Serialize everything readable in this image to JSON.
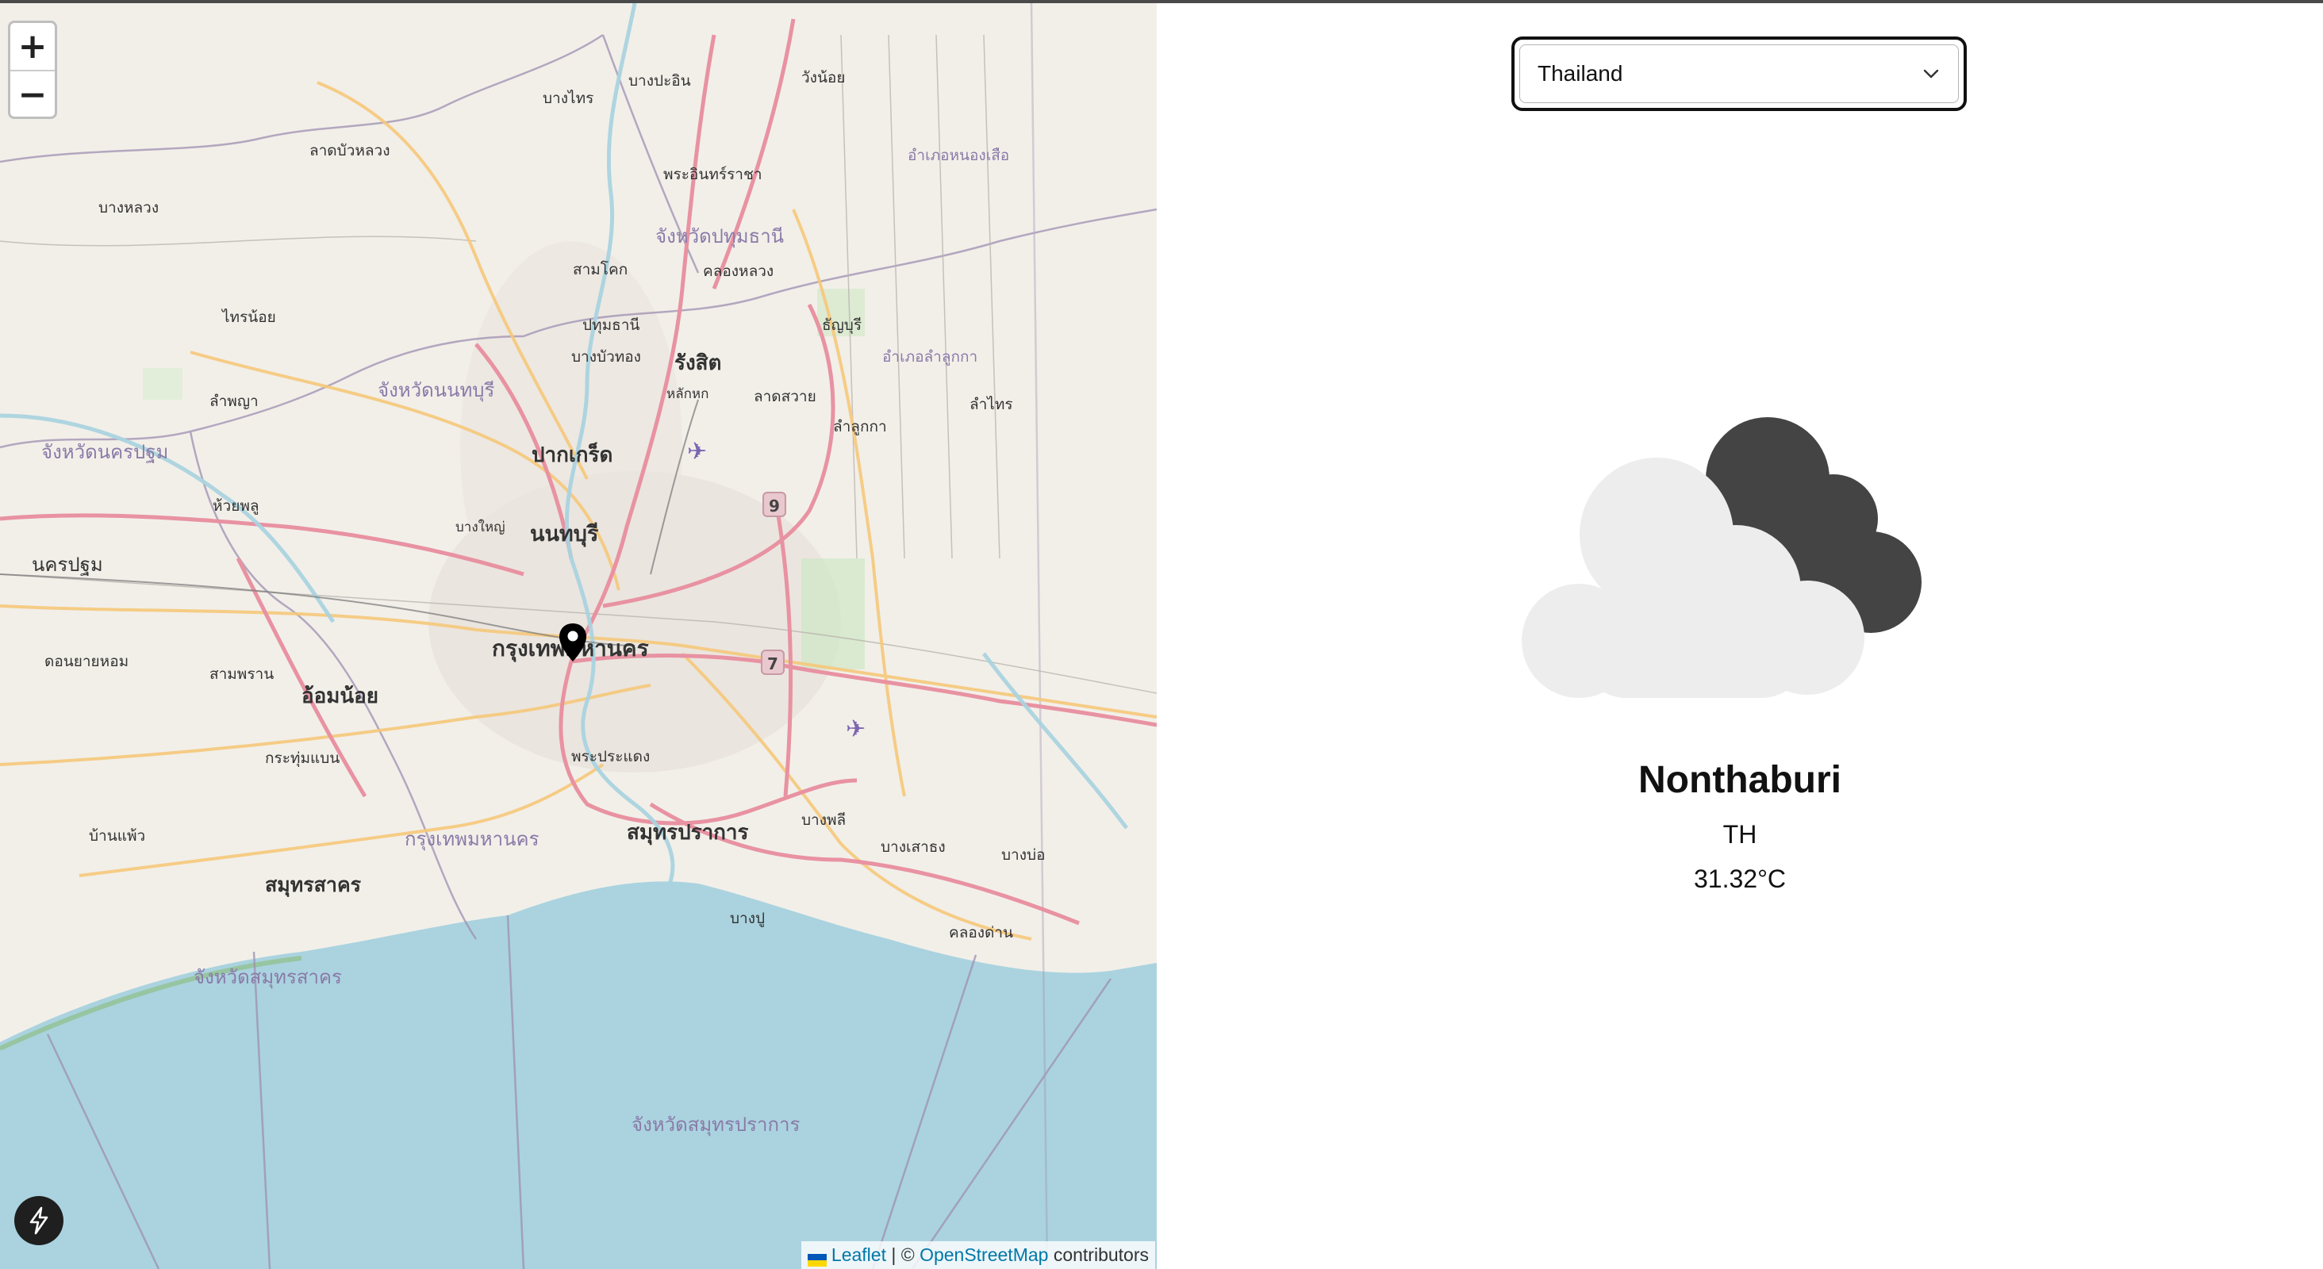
{
  "map": {
    "zoom_in_label": "+",
    "zoom_out_label": "−",
    "attribution": {
      "leaflet": "Leaflet",
      "separator": "| ©",
      "osm": "OpenStreetMap",
      "suffix": "contributors"
    },
    "labels": {
      "bangkok": "กรุงเทพมหานคร",
      "bangkok_south": "กรุงเทพมหานคร",
      "nonthaburi": "นนทบุรี",
      "pak_kret": "ปากเกร็ด",
      "rangsit": "รังสิต",
      "pathum_province": "จังหวัดปทุมธานี",
      "nonthaburi_province": "จังหวัดนนทบุรี",
      "nakhon_pathom_province": "จังหวัดนครปฐม",
      "nakhon_pathom": "นครปฐม",
      "om_noi": "อ้อมน้อย",
      "samut_prakan": "สมุทรปราการ",
      "samut_sakhon": "สมุทรสาคร",
      "samut_sakhon_province": "จังหวัดสมุทรสาคร",
      "samut_prakan_province": "จังหวัดสมุทรปราการ",
      "pathum_thani": "ปทุมธานี",
      "lat_lum_kaeo": "ลาดบัวหลวง",
      "bang_phli": "บางพลี",
      "phra_pradaeng": "พระประแดง",
      "lam_luk_ka": "ลำลูกกา",
      "thanyaburi": "ธัญบุรี",
      "nong_suea": "อำเภอหนองเสือ",
      "lam_luk_ka_district": "อำเภอลำลูกกา",
      "bang_bua_thong": "บางบัวทอง",
      "klong_luang": "คลองหลวง",
      "sam_khok": "สามโคก",
      "bang_pa_in": "บางปะอิน",
      "phra_in_racha": "พระอินทร์ราชา",
      "bang_sai": "บางไทร",
      "wang_noi": "วังน้อย",
      "lak_hok": "หลักหก",
      "lat_sawai": "ลาดสวาย",
      "bang_luang": "บางหลวง",
      "khlong_dan": "คลองด่าน",
      "bang_pu": "บางปู",
      "bang_sao_thong": "บางเสาธง",
      "krathum_baen": "กระทุ่มแบน",
      "sam_phran": "สามพราน",
      "bang_yai": "บางใหญ่",
      "sai_noi": "ไทรน้อย",
      "lam_phaya": "ลำพญา",
      "huai_phlu": "ห้วยพลู",
      "don_yai_hom": "ดอนยายหอม",
      "ban_phaeo": "บ้านแพ้ว",
      "bang_bo": "บางบ่อ",
      "lam_sai": "ลำไทร",
      "route_9": "9",
      "route_7": "7"
    }
  },
  "selector": {
    "selected": "Thailand",
    "chevron_icon": "chevron-down-icon"
  },
  "weather": {
    "icon": "cloudy-icon",
    "city": "Nonthaburi",
    "country": "TH",
    "temperature": "31.32°C"
  },
  "colors": {
    "water": "#aad3df",
    "land": "#f2efe9",
    "major_road": "#e892a2",
    "secondary_road": "#f6c87a",
    "boundary": "#9e8fb1",
    "dark_cloud": "#444444",
    "light_cloud": "#ededed"
  }
}
